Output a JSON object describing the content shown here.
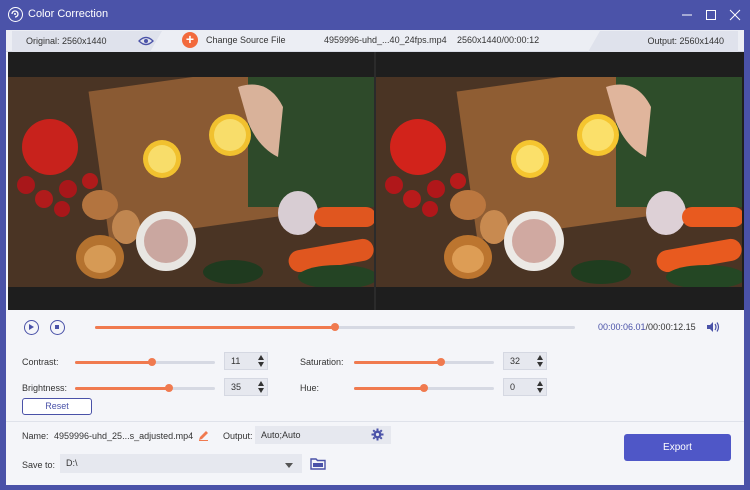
{
  "window": {
    "title": "Color Correction"
  },
  "infobar": {
    "original_label": "Original: 2560x1440",
    "change_source_label": "Change Source File",
    "file_name": "4959996-uhd_...40_24fps.mp4",
    "file_meta": "2560x1440/00:00:12",
    "output_label": "Output: 2560x1440"
  },
  "playback": {
    "current_time": "00:00:06.01",
    "total_time": "/00:00:12.15",
    "progress": 0.5
  },
  "adjustments": {
    "contrast": {
      "label": "Contrast:",
      "value": "11",
      "level": 0.55
    },
    "saturation": {
      "label": "Saturation:",
      "value": "32",
      "level": 0.62
    },
    "brightness": {
      "label": "Brightness:",
      "value": "35",
      "level": 0.67
    },
    "hue": {
      "label": "Hue:",
      "value": "0",
      "level": 0.5
    },
    "reset_label": "Reset"
  },
  "export": {
    "name_label": "Name:",
    "name_value": "4959996-uhd_25...s_adjusted.mp4",
    "output_label": "Output:",
    "output_value": "Auto;Auto",
    "save_to_label": "Save to:",
    "save_to_value": "D:\\",
    "export_label": "Export"
  },
  "colors": {
    "accent": "#f07a4f",
    "brand": "#4a52a8",
    "export": "#4f57c7"
  },
  "icons": [
    "app-logo-icon",
    "minimize-icon",
    "maximize-icon",
    "close-icon",
    "eye-icon",
    "plus-icon",
    "play-icon",
    "stop-icon",
    "volume-icon",
    "edit-icon",
    "gear-icon",
    "chevron-down-icon",
    "folder-icon"
  ]
}
